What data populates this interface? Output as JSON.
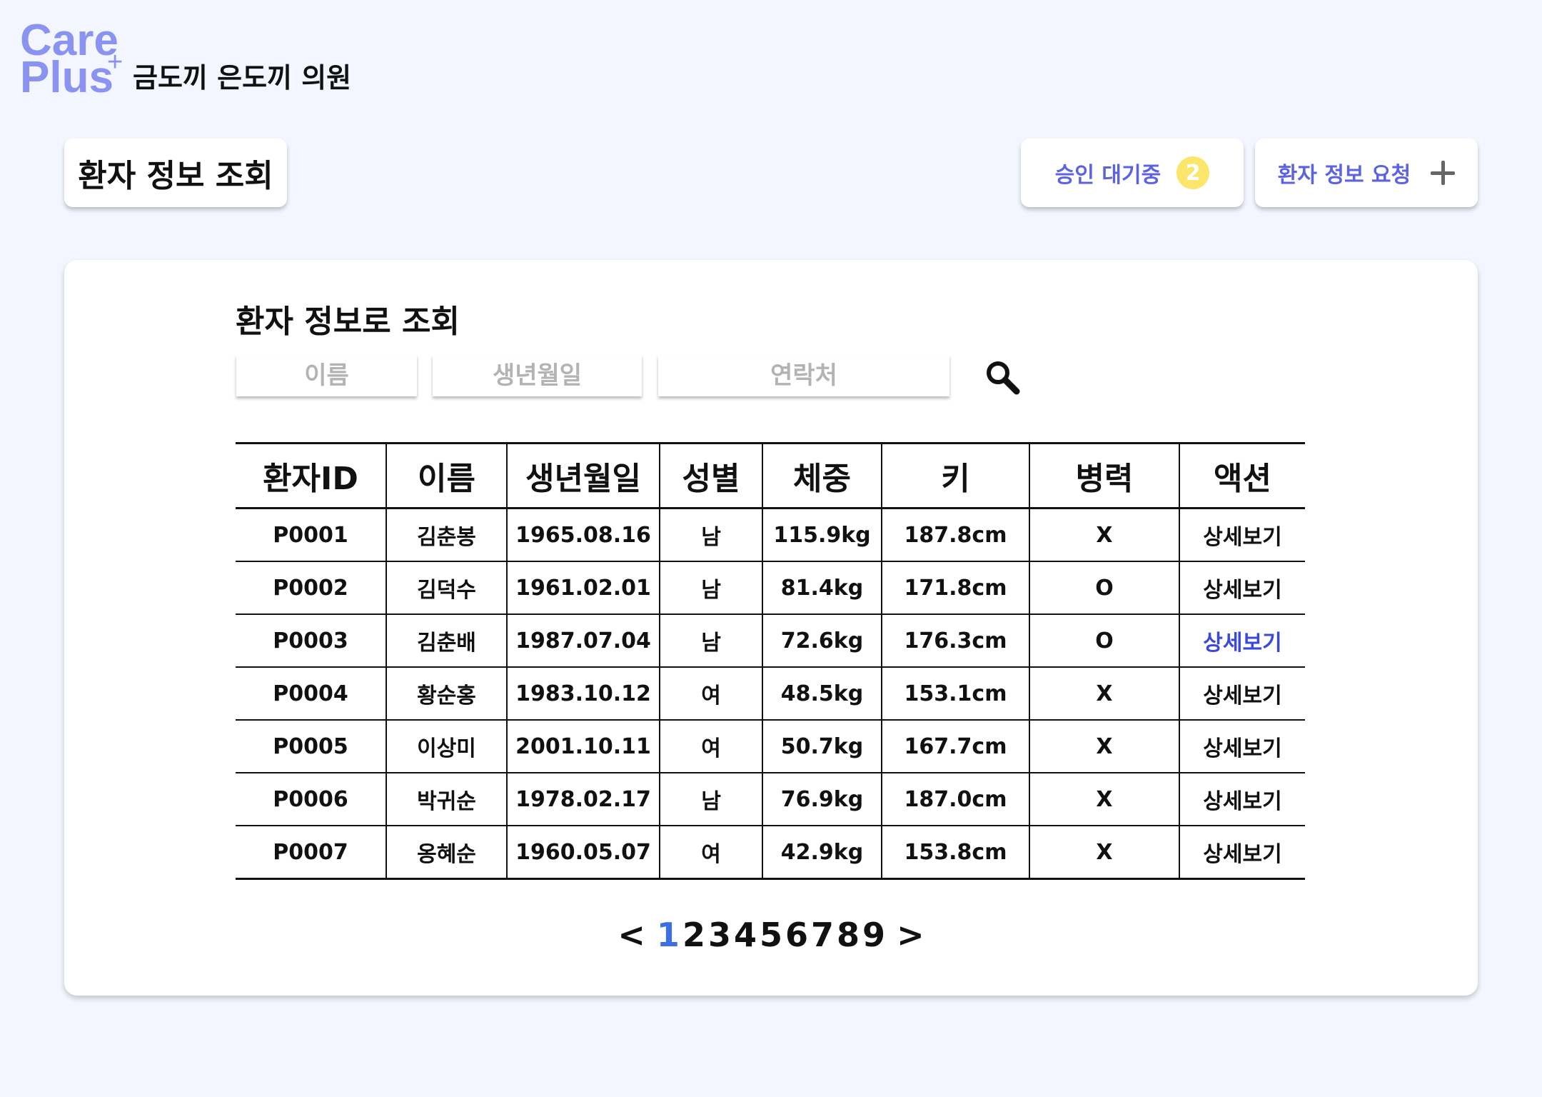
{
  "logo": {
    "line1": "Care",
    "line2": "Plus",
    "plus": "+"
  },
  "clinic_name": "금도끼 은도끼 의원",
  "page_title": "환자 정보 조회",
  "header_buttons": {
    "pending_label": "승인 대기중",
    "pending_count": "2",
    "request_label": "환자 정보 요청"
  },
  "search": {
    "title": "환자 정보로 조회",
    "name_placeholder": "이름",
    "birth_placeholder": "생년월일",
    "phone_placeholder": "연락처"
  },
  "table": {
    "headers": [
      "환자ID",
      "이름",
      "생년월일",
      "성별",
      "체중",
      "키",
      "병력",
      "액션"
    ],
    "rows": [
      [
        "P0001",
        "김춘봉",
        "1965.08.16",
        "남",
        "115.9kg",
        "187.8cm",
        "X",
        "상세보기"
      ],
      [
        "P0002",
        "김덕수",
        "1961.02.01",
        "남",
        "81.4kg",
        "171.8cm",
        "O",
        "상세보기"
      ],
      [
        "P0003",
        "김춘배",
        "1987.07.04",
        "남",
        "72.6kg",
        "176.3cm",
        "O",
        "상세보기"
      ],
      [
        "P0004",
        "황순홍",
        "1983.10.12",
        "여",
        "48.5kg",
        "153.1cm",
        "X",
        "상세보기"
      ],
      [
        "P0005",
        "이상미",
        "2001.10.11",
        "여",
        "50.7kg",
        "167.7cm",
        "X",
        "상세보기"
      ],
      [
        "P0006",
        "박귀순",
        "1978.02.17",
        "남",
        "76.9kg",
        "187.0cm",
        "X",
        "상세보기"
      ],
      [
        "P0007",
        "옹혜순",
        "1960.05.07",
        "여",
        "42.9kg",
        "153.8cm",
        "X",
        "상세보기"
      ]
    ]
  },
  "pagination": {
    "prev": "<",
    "next": ">",
    "pages": [
      "1",
      "2",
      "3",
      "4",
      "5",
      "6",
      "7",
      "8",
      "9"
    ],
    "current": "1"
  },
  "colors": {
    "background": "#f3f6ff",
    "brand": "#8b93f1",
    "accent_text": "#5b63e0",
    "badge": "#fbe56a",
    "link_active": "#3a49d8",
    "current_page": "#3b6fe6"
  },
  "icons": {
    "search": "search-icon",
    "add": "plus-icon"
  }
}
